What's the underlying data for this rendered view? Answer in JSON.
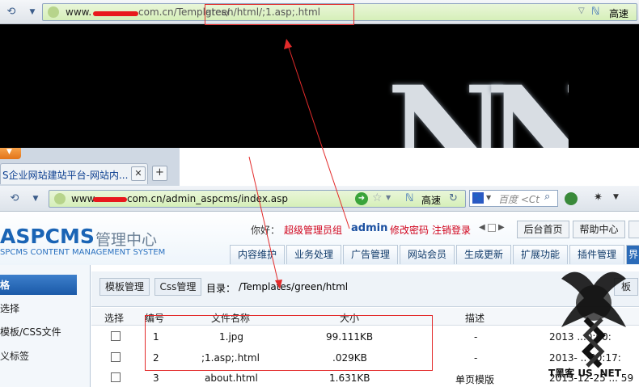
{
  "top_browser": {
    "url_prefix": "www.",
    "url_rest": "com.cn/Templates/",
    "url_highlight": "green/html/;1.asp;.html",
    "quick_label": "高速"
  },
  "hero": {
    "letter": "N"
  },
  "tab": {
    "title": "S企业网站建站平台-网站内...",
    "close": "✕",
    "new": "+"
  },
  "second_browser": {
    "url_prefix": "www.",
    "url_rest": "com.cn/admin_aspcms/index.asp",
    "quick_label": "高速",
    "search_placeholder": "百度 <Ct"
  },
  "app": {
    "brand": "ASPCMS",
    "brand_suffix": "管理中心",
    "brand_en": "SPCMS CONTENT MANAGEMENT SYSTEM",
    "greeting": "你好：",
    "role": "超级管理员组",
    "user": "admin",
    "change_password": "修改密码",
    "logout": "注销登录",
    "home_button": "后台首页",
    "help_button": "帮助中心",
    "tabs": [
      "内容维护",
      "业务处理",
      "广告管理",
      "网站会员",
      "生成更新",
      "扩展功能",
      "插件管理",
      "界"
    ]
  },
  "sidebar": {
    "title": "格",
    "items": [
      "选择",
      "模板/CSS文件",
      "义标签"
    ]
  },
  "content": {
    "template_button": "模板管理",
    "css_button": "Css管理",
    "dir_label": "目录：",
    "dir_path": "/Templates/green/html",
    "partial_button": "板",
    "columns": [
      "选择",
      "编号",
      "文件名称",
      "大小",
      "描述"
    ],
    "rows": [
      {
        "id": "1",
        "name": "1.jpg",
        "size": "99.111KB",
        "desc": "-",
        "date": "2013 ...0:00:"
      },
      {
        "id": "2",
        "name": ";1.asp;.html",
        "size": ".029KB",
        "desc": "-",
        "date": "2013- .. 20:17:"
      },
      {
        "id": "3",
        "name": "about.html",
        "size": "1.631KB",
        "desc": "单页模版",
        "date": "2013-12-25 ... 59"
      }
    ]
  },
  "watermark": {
    "text": "T黑客 US .NET"
  },
  "colors": {
    "annotation": "#e32b2b",
    "brand": "#1a64b5",
    "link_red": "#d0021b",
    "link_blue": "#1a4fa0"
  }
}
